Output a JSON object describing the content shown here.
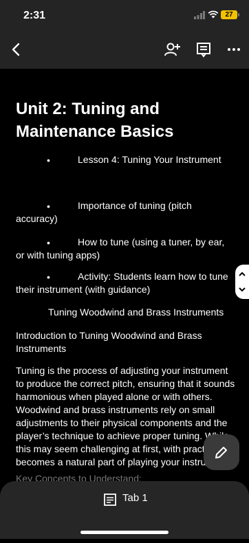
{
  "status": {
    "time": "2:31",
    "battery": "27"
  },
  "toolbar": {
    "icons": [
      "back-icon",
      "add-person-icon",
      "comments-icon",
      "more-icon"
    ]
  },
  "doc": {
    "title": "Unit 2: Tuning and Maintenance Basics",
    "bullets": [
      {
        "line1": "Lesson 4: Tuning Your Instrument"
      },
      {
        "line1": "Importance of tuning (pitch",
        "line2": "accuracy)"
      },
      {
        "line1": "How to tune (using a tuner, by ear,",
        "line2": "or with tuning apps)"
      },
      {
        "line1": "Activity: Students learn how to tune",
        "line2": "their instrument (with guidance)"
      }
    ],
    "section_heading": "Tuning Woodwind and Brass Instruments",
    "intro_line1": "Introduction to Tuning Woodwind and Brass",
    "intro_line2": "Instruments",
    "para_lines": [
      "Tuning is the process of adjusting your instrument",
      "to produce the correct pitch, ensuring that it sounds",
      "harmonious when played alone or with others.",
      "Woodwind and brass instruments rely on small",
      "adjustments to their physical components and the",
      "player’s technique to achieve proper tuning. While",
      "this may seem challenging at first, with practi",
      "becomes a natural part of playing your instru"
    ],
    "cut_line": "Key Concepts to Understand:"
  },
  "bottom": {
    "tab_label": "Tab 1"
  },
  "colors": {
    "bar_bg": "#242424",
    "battery": "#f2c200",
    "sheet_bg": "#262626",
    "fab_bg": "#3a3a3a"
  }
}
